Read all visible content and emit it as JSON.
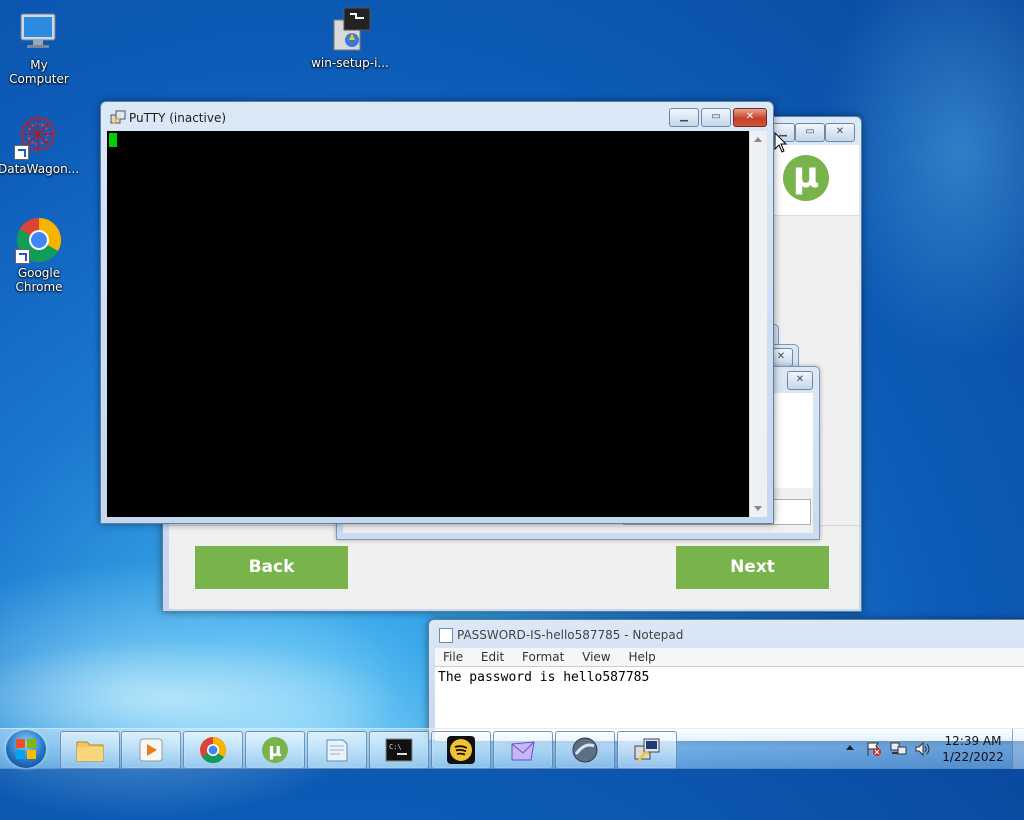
{
  "desktop": {
    "icons": [
      {
        "label": "My Computer"
      },
      {
        "label": "win-setup-i..."
      },
      {
        "label": "DataWagon..."
      },
      {
        "label": "Google Chrome"
      }
    ]
  },
  "putty": {
    "title": "PuTTY (inactive)",
    "min_glyph": "▁",
    "max_glyph": "▭",
    "close_glyph": "✕"
  },
  "utorrent": {
    "back_label": "Back",
    "next_label": "Next",
    "logo_glyph": "µ",
    "close_glyph": "✕",
    "max_glyph": "▭",
    "min_glyph": "▁"
  },
  "notepad": {
    "title": "PASSWORD-IS-hello587785 - Notepad",
    "menu": [
      "File",
      "Edit",
      "Format",
      "View",
      "Help"
    ],
    "content": "The password is hello587785"
  },
  "taskbar": {
    "clock_time": "12:39 AM",
    "clock_date": "1/22/2022",
    "buttons": [
      "start",
      "explorer",
      "media-player",
      "chrome",
      "utorrent",
      "notepad",
      "cmd",
      "spotify",
      "mail",
      "app",
      "putty"
    ]
  },
  "colors": {
    "accent_green": "#78b34b",
    "terminal_bg": "#000000",
    "cursor": "#00d000"
  }
}
